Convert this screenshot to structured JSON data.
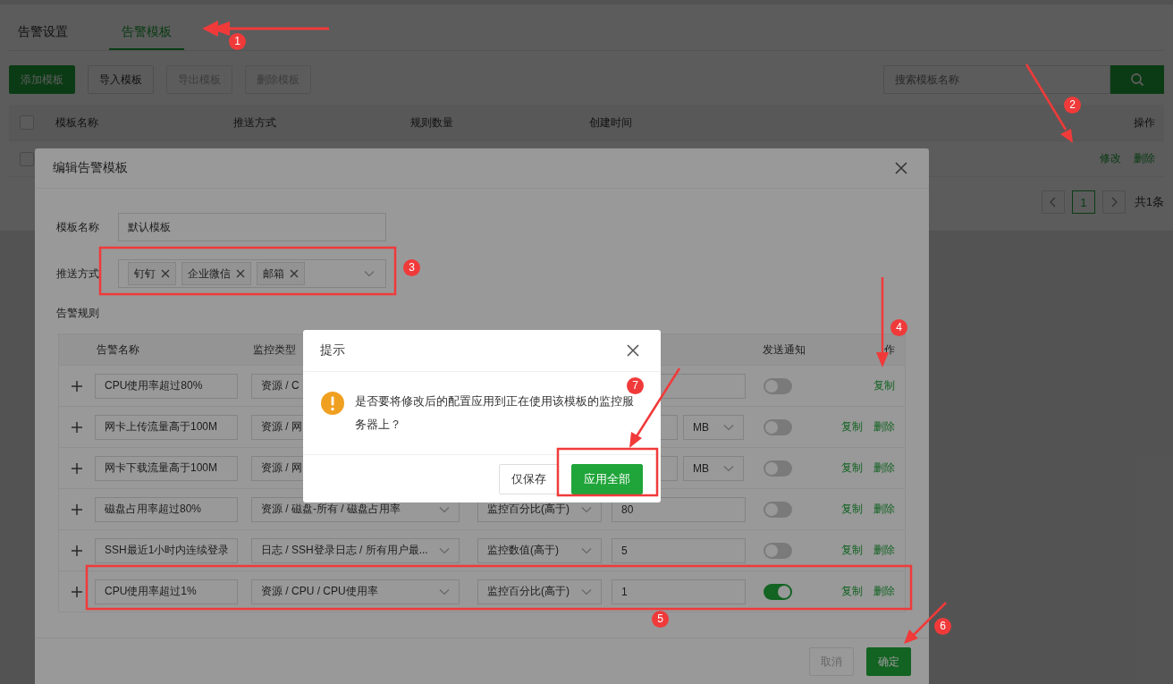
{
  "tabs": [
    {
      "label": "告警设置",
      "selected": false
    },
    {
      "label": "告警模板",
      "selected": true
    }
  ],
  "toolbar": {
    "buttons": [
      {
        "label": "添加模板",
        "kind": "primary",
        "disabled": false
      },
      {
        "label": "导入模板",
        "kind": "default",
        "disabled": false
      },
      {
        "label": "导出模板",
        "kind": "default",
        "disabled": true
      },
      {
        "label": "删除模板",
        "kind": "default",
        "disabled": true
      }
    ],
    "search": {
      "placeholder": "搜索模板名称"
    }
  },
  "template_table": {
    "select_all": {
      "checked": false
    },
    "columns": [
      "模板名称",
      "推送方式",
      "规则数量",
      "创建时间",
      "操作"
    ],
    "rows": [
      {
        "checked": false,
        "actions": [
          "修改",
          "删除"
        ]
      }
    ]
  },
  "pagination": {
    "pages": [
      {
        "label": "1",
        "selected": true
      }
    ],
    "total": "共1条"
  },
  "edit_modal": {
    "title": "编辑告警模板",
    "name_label": "模板名称",
    "name_value": "默认模板",
    "push_label": "推送方式",
    "push_tags": [
      "钉钉",
      "企业微信",
      "邮箱"
    ],
    "rules_label": "告警规则",
    "rules_table": {
      "headers": {
        "name": "告警名称",
        "type": "监控类型",
        "notify": "发送通知",
        "actions": "作"
      },
      "rows": [
        {
          "name": "CPU使用率超过80%",
          "type": "资源 / C",
          "notify": false,
          "actions": [
            "复制"
          ]
        },
        {
          "name": "网卡上传流量高于100M",
          "type": "资源 / 网",
          "unit": "MB",
          "notify": false,
          "actions": [
            "复制",
            "删除"
          ]
        },
        {
          "name": "网卡下载流量高于100M",
          "type": "资源 / 网",
          "unit": "MB",
          "notify": false,
          "actions": [
            "复制",
            "删除"
          ]
        },
        {
          "name": "磁盘占用率超过80%",
          "type": "资源 / 磁盘-所有 / 磁盘占用率",
          "condition": "监控百分比(高于)",
          "value": "80",
          "notify": false,
          "actions": [
            "复制",
            "删除"
          ]
        },
        {
          "name": "SSH最近1小时内连续登录",
          "type": "日志 / SSH登录日志 / 所有用户最...",
          "condition": "监控数值(高于)",
          "value": "5",
          "notify": false,
          "actions": [
            "复制",
            "删除"
          ]
        },
        {
          "name": "CPU使用率超过1%",
          "type": "资源 / CPU / CPU使用率",
          "condition": "监控百分比(高于)",
          "value": "1",
          "notify": true,
          "actions": [
            "复制",
            "删除"
          ]
        }
      ]
    },
    "buttons": [
      {
        "label": "取消",
        "kind": "default",
        "disabled": true
      },
      {
        "label": "确定",
        "kind": "primary",
        "disabled": false
      }
    ]
  },
  "prompt": {
    "title": "提示",
    "message": "是否要将修改后的配置应用到正在使用该模板的监控服务器上？",
    "buttons": [
      {
        "label": "仅保存",
        "kind": "default"
      },
      {
        "label": "应用全部",
        "kind": "primary"
      }
    ]
  },
  "annotations": [
    "1",
    "2",
    "3",
    "4",
    "5",
    "6",
    "7"
  ]
}
